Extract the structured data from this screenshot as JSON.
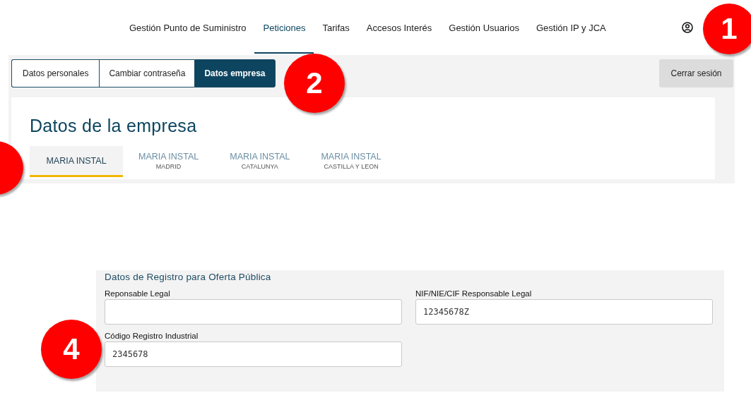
{
  "nav": {
    "items": [
      {
        "label": "Gestión Punto de Suministro",
        "selected": false
      },
      {
        "label": "Peticiones",
        "selected": true
      },
      {
        "label": "Tarifas",
        "selected": false
      },
      {
        "label": "Accesos Interés",
        "selected": false
      },
      {
        "label": "Gestión Usuarios",
        "selected": false
      },
      {
        "label": "Gestión IP y JCA",
        "selected": false
      }
    ]
  },
  "account_tabs": [
    {
      "label": "Datos personales",
      "selected": false
    },
    {
      "label": "Cambiar contraseña",
      "selected": false
    },
    {
      "label": "Datos empresa",
      "selected": true
    }
  ],
  "logout_button": "Cerrar sesión",
  "page_title": "Datos de la empresa",
  "company_tabs": [
    {
      "name": "MARIA INSTAL",
      "selected": true
    },
    {
      "name": "MARIA INSTAL",
      "region": "MADRID",
      "selected": false
    },
    {
      "name": "MARIA INSTAL",
      "region": "CATALUNYA",
      "selected": false
    },
    {
      "name": "MARIA INSTAL",
      "region": "CASTILLA Y LEON",
      "selected": false
    }
  ],
  "section": {
    "title": "Datos de Registro para Oferta Pública",
    "fields": [
      {
        "label": "Reponsable Legal"
      },
      {
        "label": "NIF/NIE/CIF Responsable Legal",
        "value": "12345678Z"
      },
      {
        "label": "Código Registro Industrial",
        "value": "2345678"
      }
    ]
  },
  "callouts": [
    {
      "number": "1"
    },
    {
      "number": "2"
    },
    {
      "number": "4"
    }
  ]
}
